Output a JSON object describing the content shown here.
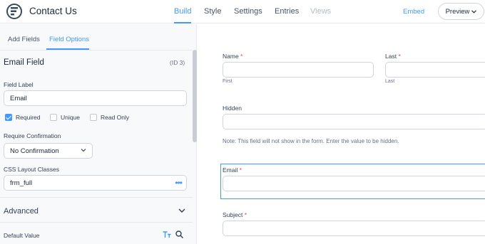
{
  "header": {
    "title": "Contact Us",
    "nav": [
      {
        "label": "Build"
      },
      {
        "label": "Style"
      },
      {
        "label": "Settings"
      },
      {
        "label": "Entries"
      },
      {
        "label": "Views"
      }
    ],
    "embed_label": "Embed",
    "preview_label": "Preview"
  },
  "panel": {
    "tabs": [
      {
        "label": "Add Fields"
      },
      {
        "label": "Field Options"
      }
    ],
    "field_title": "Email Field",
    "field_id": "(ID 3)",
    "field_label_caption": "Field Label",
    "field_label_value": "Email",
    "checkboxes": [
      {
        "label": "Required",
        "checked": true
      },
      {
        "label": "Unique",
        "checked": false
      },
      {
        "label": "Read Only",
        "checked": false
      }
    ],
    "confirmation_caption": "Require Confirmation",
    "confirmation_value": "No Confirmation",
    "css_caption": "CSS Layout Classes",
    "css_value": "frm_full",
    "advanced_title": "Advanced",
    "default_value_caption": "Default Value"
  },
  "form": {
    "name_label": "Name",
    "last_label": "Last",
    "first_sub": "First",
    "last_sub": "Last",
    "hidden_label": "Hidden",
    "hidden_note": "Note: This field will not show in the form. Enter the value to be hidden.",
    "email_label": "Email",
    "subject_label": "Subject",
    "required_mark": "*"
  },
  "colors": {
    "accent": "#4199fd",
    "required": "#e5484d"
  }
}
